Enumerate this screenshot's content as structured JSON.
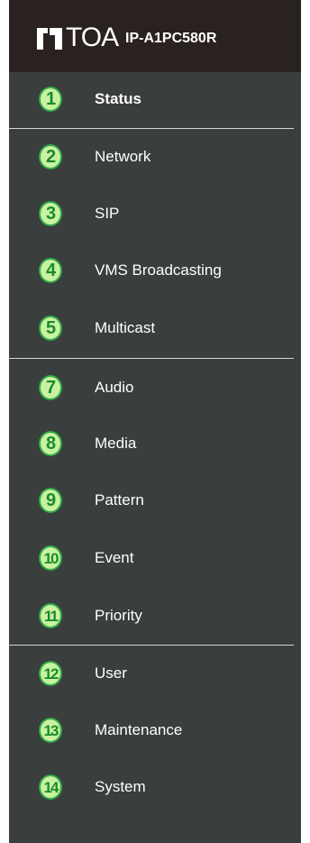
{
  "header": {
    "brand": "TOA",
    "model": "IP-A1PC580R"
  },
  "colors": {
    "header_bg": "#2a2220",
    "sidebar_bg": "#3a3e3d",
    "badge_fill": "#c9f2a0",
    "badge_border": "#2faa4a",
    "badge_text": "#1a8a2e",
    "divider": "#d6d6d6"
  },
  "nav": {
    "items": [
      {
        "number": "1",
        "label": "Status",
        "icon": "status",
        "active": true
      },
      {
        "number": "2",
        "label": "Network",
        "icon": "network"
      },
      {
        "number": "3",
        "label": "SIP",
        "icon": "sip"
      },
      {
        "number": "4",
        "label": "VMS Broadcasting",
        "icon": "vms"
      },
      {
        "number": "5",
        "label": "Multicast",
        "icon": "multicast"
      },
      {
        "number": "7",
        "label": "Audio",
        "icon": "audio"
      },
      {
        "number": "8",
        "label": "Media",
        "icon": "media"
      },
      {
        "number": "9",
        "label": "Pattern",
        "icon": "pattern"
      },
      {
        "number": "10",
        "label": "Event",
        "icon": "event"
      },
      {
        "number": "11",
        "label": "Priority",
        "icon": "priority"
      },
      {
        "number": "12",
        "label": "User",
        "icon": "user"
      },
      {
        "number": "13",
        "label": "Maintenance",
        "icon": "maintenance"
      },
      {
        "number": "14",
        "label": "System",
        "icon": "system"
      }
    ]
  }
}
